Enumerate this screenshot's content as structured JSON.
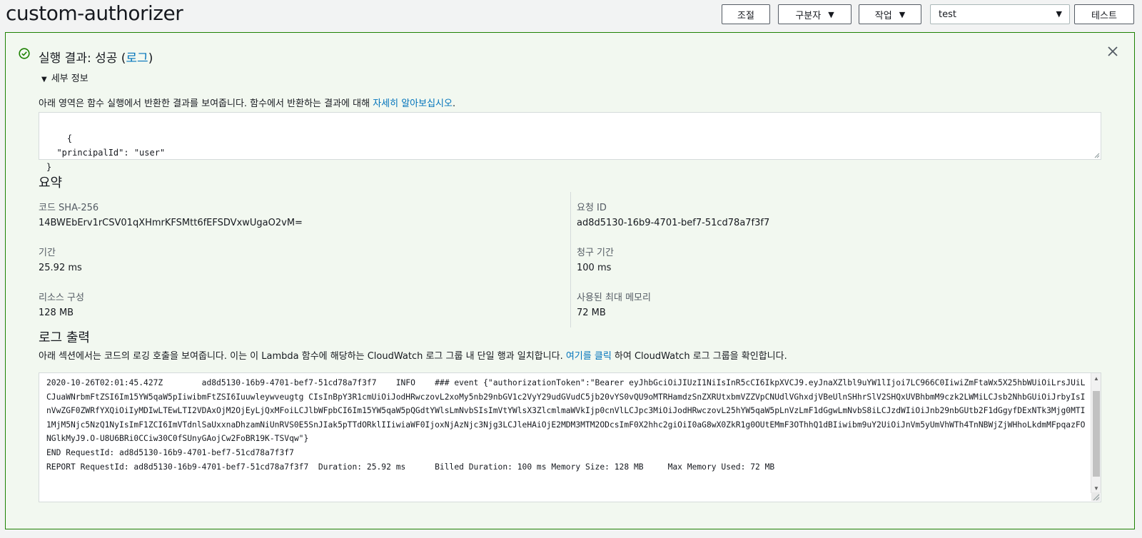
{
  "header": {
    "title": "custom-authorizer",
    "buttons": {
      "throttle": "조절",
      "qualifiers": "구분자",
      "actions": "작업",
      "test": "테스트"
    },
    "test_event_select": "test"
  },
  "result": {
    "status_prefix": "실행 결과: 성공 (",
    "status_link": "로그",
    "status_suffix": ")",
    "details_toggle": "세부 정보",
    "description_prefix": "아래 영역은 함수 실행에서 반환한 결과를 보여줍니다. 함수에서 반환하는 결과에 대해 ",
    "description_link": "자세히 알아보십시오",
    "description_suffix": ".",
    "output": "{\n  \"principalId\": \"user\"\n}"
  },
  "summary": {
    "heading": "요약",
    "code_sha_label": "코드 SHA-256",
    "code_sha_value": "14BWEbErv1rCSV01qXHmrKFSMtt6fEFSDVxwUgaO2vM=",
    "request_id_label": "요청 ID",
    "request_id_value": "ad8d5130-16b9-4701-bef7-51cd78a7f3f7",
    "duration_label": "기간",
    "duration_value": "25.92 ms",
    "billed_label": "청구 기간",
    "billed_value": "100 ms",
    "resources_label": "리소스 구성",
    "resources_value": "128 MB",
    "max_memory_label": "사용된 최대 메모리",
    "max_memory_value": "72 MB"
  },
  "log": {
    "heading": "로그 출력",
    "description_prefix": "아래 섹션에서는 코드의 로깅 호출을 보여줍니다. 이는 이 Lambda 함수에 해당하는 CloudWatch 로그 그룹 내 단일 행과 일치합니다. ",
    "description_link": "여기를 클릭",
    "description_suffix": " 하여 CloudWatch 로그 그룹을 확인합니다.",
    "output": "2020-10-26T02:01:45.427Z\tad8d5130-16b9-4701-bef7-51cd78a7f3f7\tINFO\t### event {\"authorizationToken\":\"Bearer eyJhbGciOiJIUzI1NiIsInR5cCI6IkpXVCJ9.eyJnaXZlbl9uYW1lIjoi7LC966C0IiwiZmFtaWx5X25hbWUiOiLrsJUiLCJuaWNrbmFtZSI6Im15YW5qaW5pIiwibmFtZSI6Iuuwleywveugtg CIsInBpY3R1cmUiOiJodHRwczovL2xoMy5nb29nbGV1c2VyY29udGVudC5jb20vYS0vQU9oMTRHamdzSnZXRUtxbmVZZVpCNUdlVGhxdjVBeUlnSHhrSlV2SHQxUVBhbmM9czk2LWMiLCJsb2NhbGUiOiJrbyIsInVwZGF0ZWRfYXQiOiIyMDIwLTEwLTI2VDAxOjM2OjEyLjQxMFoiLCJlbWFpbCI6Im15YW5qaW5pQGdtYWlsLmNvbSIsImVtYWlsX3ZlcmlmaWVkIjp0cnVlLCJpc3MiOiJodHRwczovL25hYW5qaW5pLnVzLmF1dGgwLmNvbS8iLCJzdWIiOiJnb29nbGUtb2F1dGgyfDExNTk3Mjg0MTI1MjM5Njc5NzQ1NyIsImF1ZCI6ImVTdnlSaUxxnaDhzamNiUnRVS0E5SnJIak5pTTdORklIIiwiaWF0IjoxNjAzNjc3Njg3LCJleHAiOjE2MDM3MTM2ODcsImF0X2hhc2giOiI0aG8wX0ZkR1g0OUtEMmF3OThhQ1dBIiwibm9uY2UiOiJnVm5yUmVhWTh4TnNBWjZjWHhoLkdmMFpqazFONGlkMyJ9.O-U8U6BRi0CCiw30C0fSUnyGAojCw2FoBR19K-TSVqw\"}\nEND RequestId: ad8d5130-16b9-4701-bef7-51cd78a7f3f7\nREPORT RequestId: ad8d5130-16b9-4701-bef7-51cd78a7f3f7\tDuration: 25.92 ms\tBilled Duration: 100 ms\tMemory Size: 128 MB\tMax Memory Used: 72 MB"
  },
  "colors": {
    "success": "#1d8102",
    "link": "#0073bb",
    "panel_bg": "#f2f8f0"
  },
  "icons": [
    "check-circle-icon",
    "close-icon",
    "caret-down-icon",
    "resize-handle-icon"
  ]
}
